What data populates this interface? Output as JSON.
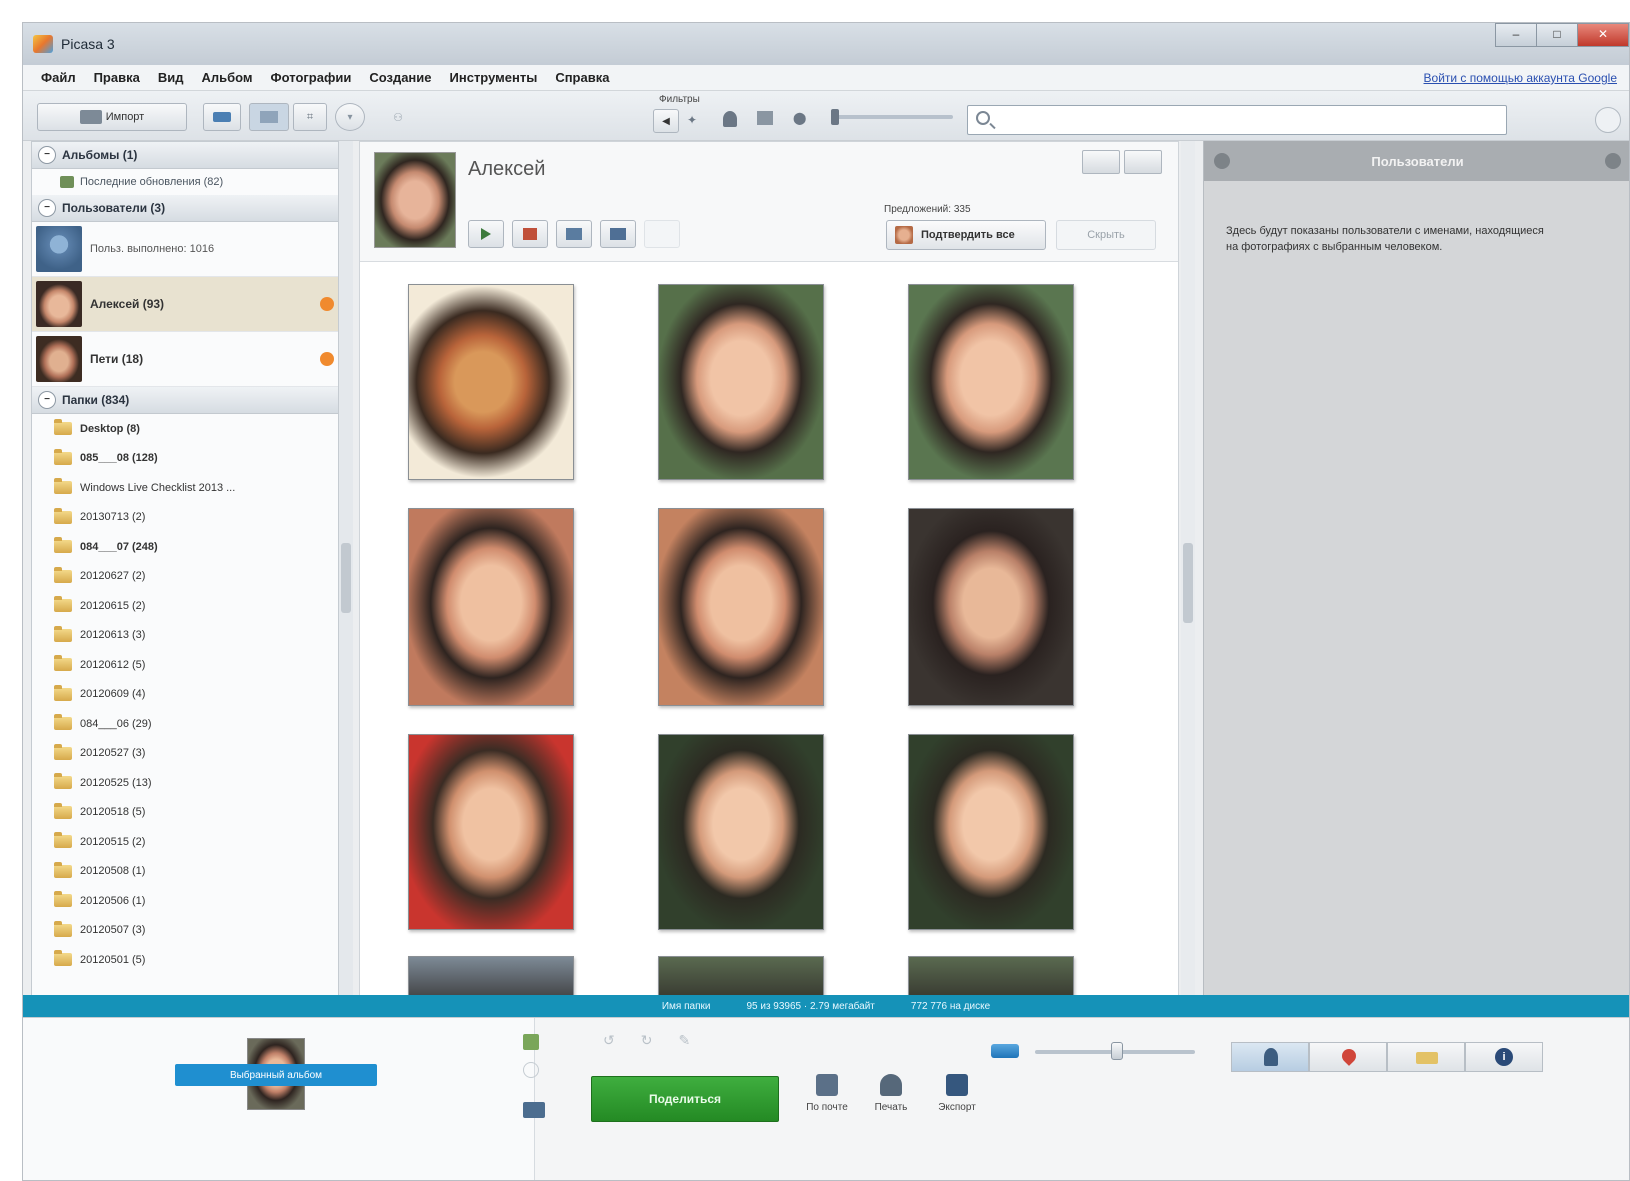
{
  "window": {
    "title": "Picasa 3",
    "controls": [
      "–",
      "□",
      "✕"
    ]
  },
  "menu": {
    "items": [
      "Файл",
      "Правка",
      "Вид",
      "Альбом",
      "Фотографии",
      "Создание",
      "Инструменты",
      "Справка"
    ],
    "signin": "Войти с помощью аккаунта Google"
  },
  "toolbar": {
    "import_label": "Импорт",
    "filters_label": "Фильтры",
    "search_placeholder": ""
  },
  "left_panel": {
    "albums_header": "Альбомы (1)",
    "albums_item": "Последние обновления (82)",
    "people_header": "Пользователи (3)",
    "people": [
      {
        "label": "Польз. выполнено: 1016",
        "selected": false,
        "dot": false
      },
      {
        "label": "Алексей (93)",
        "selected": true,
        "dot": true
      },
      {
        "label": "Пети (18)",
        "selected": false,
        "dot": true
      }
    ],
    "folders_header": "Папки (834)",
    "folders": [
      {
        "label": "Desktop (8)",
        "bold": true
      },
      {
        "label": "085___08 (128)",
        "bold": true
      },
      {
        "label": "Windows Live Checklist 2013 ...",
        "bold": false
      },
      {
        "label": "20130713 (2)",
        "bold": false
      },
      {
        "label": "084___07 (248)",
        "bold": true
      },
      {
        "label": "20120627 (2)",
        "bold": false
      },
      {
        "label": "20120615 (2)",
        "bold": false
      },
      {
        "label": "20120613 (3)",
        "bold": false
      },
      {
        "label": "20120612 (5)",
        "bold": false
      },
      {
        "label": "20120609 (4)",
        "bold": false
      },
      {
        "label": "084___06 (29)",
        "bold": false
      },
      {
        "label": "20120527 (3)",
        "bold": false
      },
      {
        "label": "20120525 (13)",
        "bold": false
      },
      {
        "label": "20120518 (5)",
        "bold": false
      },
      {
        "label": "20120515 (2)",
        "bold": false
      },
      {
        "label": "20120508 (1)",
        "bold": false
      },
      {
        "label": "20120506 (1)",
        "bold": false
      },
      {
        "label": "20120507 (3)",
        "bold": false
      },
      {
        "label": "20120501 (5)",
        "bold": false
      }
    ]
  },
  "center": {
    "person_name": "Алексей",
    "suggested_label": "Предложений: 335",
    "confirm_label": "Подтвердить все",
    "hide_label": "Скрыть"
  },
  "right_panel": {
    "title": "Пользователи",
    "hint": "Здесь будут показаны пользователи с именами, находящиеся на фотографиях с выбранным человеком."
  },
  "statusbar": {
    "items": [
      "Имя папки",
      "95 из 93965 · 2.79 мегабайт",
      "772 776 на диске"
    ]
  },
  "tray": {
    "selection_label": "Выбранный альбом",
    "share_label": "Поделиться",
    "actions": [
      "По почте",
      "Печать",
      "Экспорт"
    ]
  }
}
